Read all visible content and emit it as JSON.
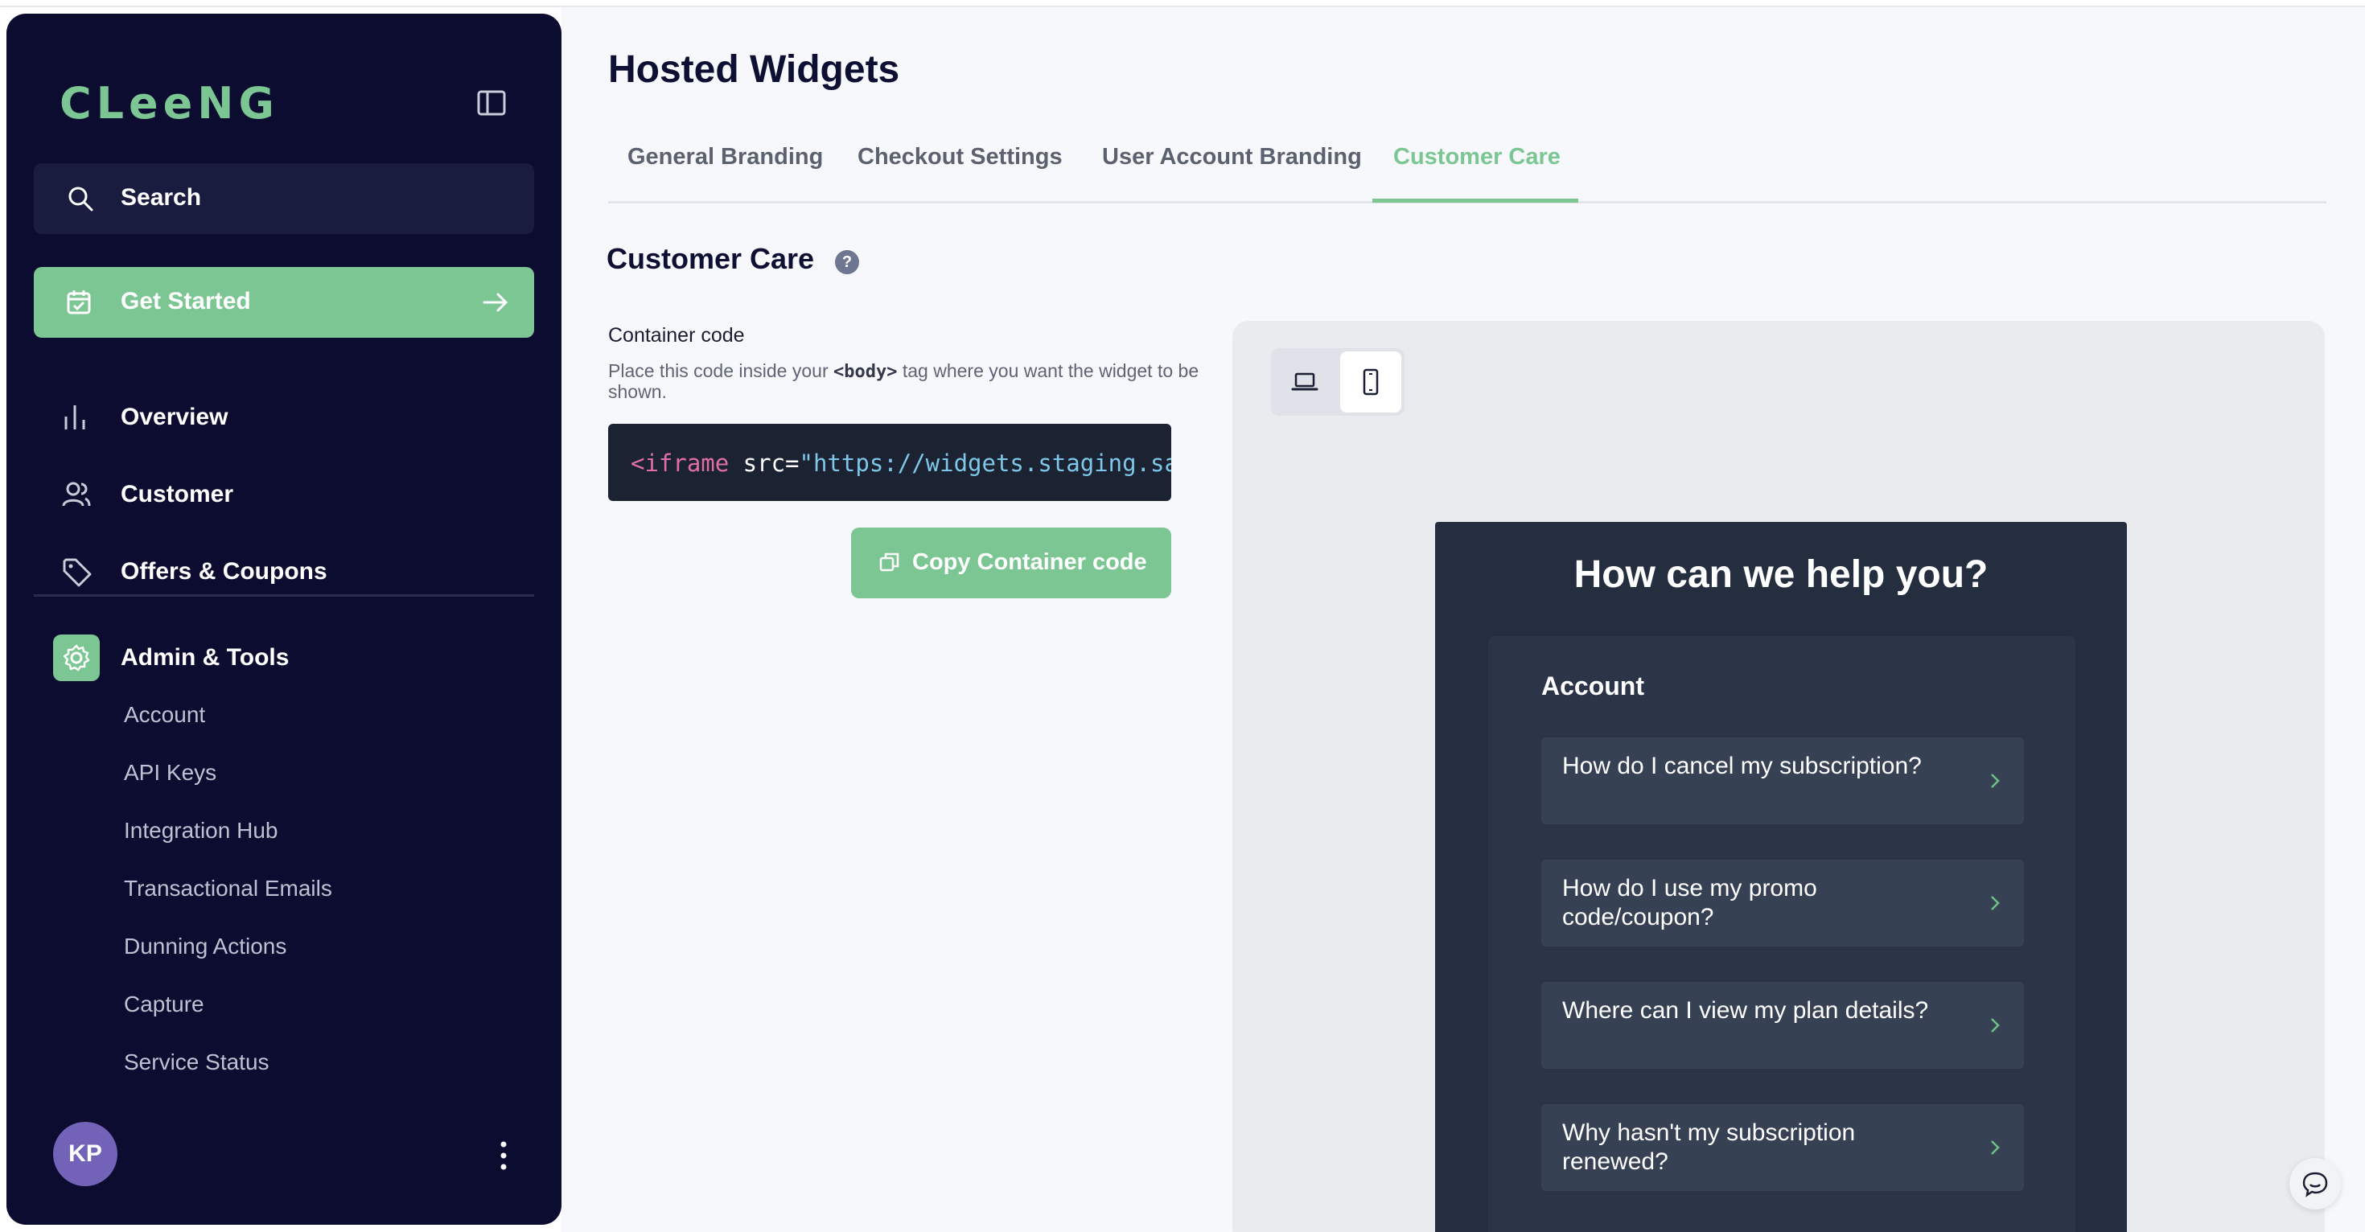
{
  "sidebar": {
    "logo": "CLeeNG",
    "search_label": "Search",
    "get_started_label": "Get Started",
    "nav": {
      "overview": "Overview",
      "customer": "Customer",
      "offers": "Offers & Coupons",
      "admin": "Admin & Tools"
    },
    "admin_items": [
      "Account",
      "API Keys",
      "Integration Hub",
      "Transactional Emails",
      "Dunning Actions",
      "Capture",
      "Service Status"
    ],
    "user_initials": "KP"
  },
  "main": {
    "title": "Hosted Widgets",
    "tabs": [
      "General Branding",
      "Checkout Settings",
      "User Account Branding",
      "Customer Care"
    ],
    "active_tab": "Customer Care",
    "section_title": "Customer Care",
    "help_icon": "?",
    "container_label": "Container code",
    "hint_before": "Place this code inside your ",
    "hint_code": "<body>",
    "hint_after": " tag where you want the widget to be shown.",
    "code": {
      "tag": "<iframe",
      "attr": " src=",
      "value": "\"https://widgets.staging.sandbox.cleeng.com/"
    },
    "copy_button": "Copy Container code"
  },
  "preview": {
    "widget_title": "How can we help you?",
    "account_heading": "Account",
    "questions": [
      "How do I cancel my subscription?",
      "How do I use my promo code/coupon?",
      "Where can I view my plan details?",
      "Why hasn't my subscription renewed?"
    ]
  },
  "icons": {
    "collapse": "sidebar-collapse-icon",
    "search": "search-icon",
    "calendar": "calendar-check-icon",
    "arrow": "arrow-right-icon",
    "overview": "bar-chart-icon",
    "customer": "users-icon",
    "offers": "tag-icon",
    "admin": "gear-icon",
    "more": "more-vertical-icon",
    "copy": "copy-icon",
    "desktop": "laptop-icon",
    "mobile": "smartphone-icon",
    "chat": "chat-icon"
  },
  "colors": {
    "sidebar_bg": "#0b0c30",
    "accent": "#7bc692",
    "widget_bg": "#252e3f",
    "avatar": "#7263b8"
  }
}
